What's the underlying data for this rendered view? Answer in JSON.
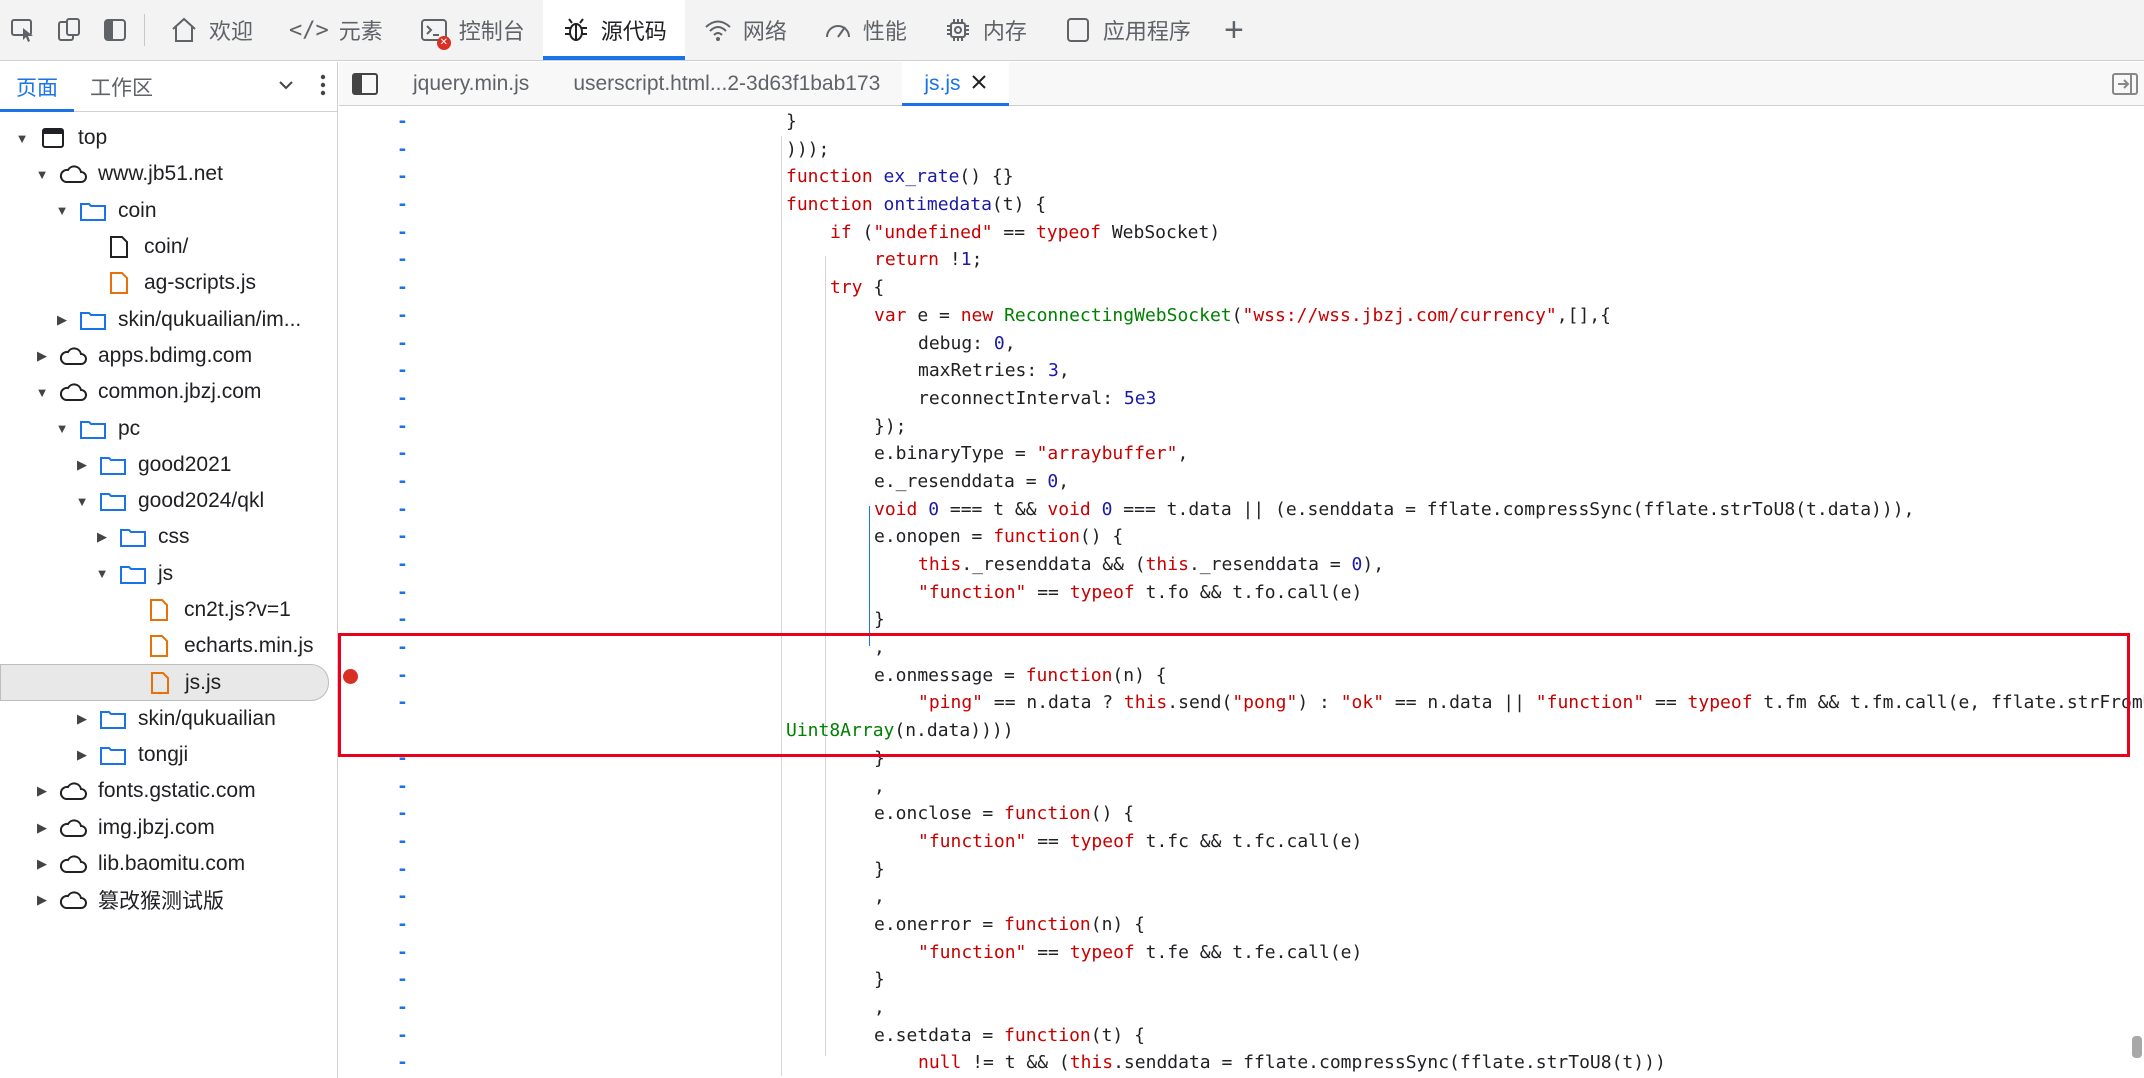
{
  "toolbar": {
    "tabs": [
      {
        "label": "欢迎"
      },
      {
        "label": "元素"
      },
      {
        "label": "控制台"
      },
      {
        "label": "源代码"
      },
      {
        "label": "网络"
      },
      {
        "label": "性能"
      },
      {
        "label": "内存"
      },
      {
        "label": "应用程序"
      }
    ],
    "active_tab": "源代码",
    "accent": "#1a73e8"
  },
  "navigator": {
    "tabs": [
      {
        "label": "页面"
      },
      {
        "label": "工作区"
      }
    ],
    "tree": [
      {
        "label": "top"
      },
      {
        "label": "www.jb51.net"
      },
      {
        "label": "coin"
      },
      {
        "label": "coin/"
      },
      {
        "label": "ag-scripts.js"
      },
      {
        "label": "skin/qukuailian/im..."
      },
      {
        "label": "apps.bdimg.com"
      },
      {
        "label": "common.jbzj.com"
      },
      {
        "label": "pc"
      },
      {
        "label": "good2021"
      },
      {
        "label": "good2024/qkl"
      },
      {
        "label": "css"
      },
      {
        "label": "js"
      },
      {
        "label": "cn2t.js?v=1"
      },
      {
        "label": "echarts.min.js"
      },
      {
        "label": "js.js"
      },
      {
        "label": "skin/qukuailian"
      },
      {
        "label": "tongji"
      },
      {
        "label": "fonts.gstatic.com"
      },
      {
        "label": "img.jbzj.com"
      },
      {
        "label": "lib.baomitu.com"
      },
      {
        "label": "篡改猴测试版"
      }
    ],
    "selected": "js.js"
  },
  "editor": {
    "tabs": [
      {
        "label": "jquery.min.js"
      },
      {
        "label": "userscript.html...2-3d63f1bab173"
      },
      {
        "label": "js.js"
      }
    ],
    "active_tab": "js.js",
    "breakpoint_line": "e.onmessage = function(n) {",
    "colors": {
      "keyword": "#c80000",
      "number": "#1a1aa6",
      "class": "#008000",
      "breakpoint": "#d93025",
      "highlight_box": "#e8001c"
    }
  }
}
